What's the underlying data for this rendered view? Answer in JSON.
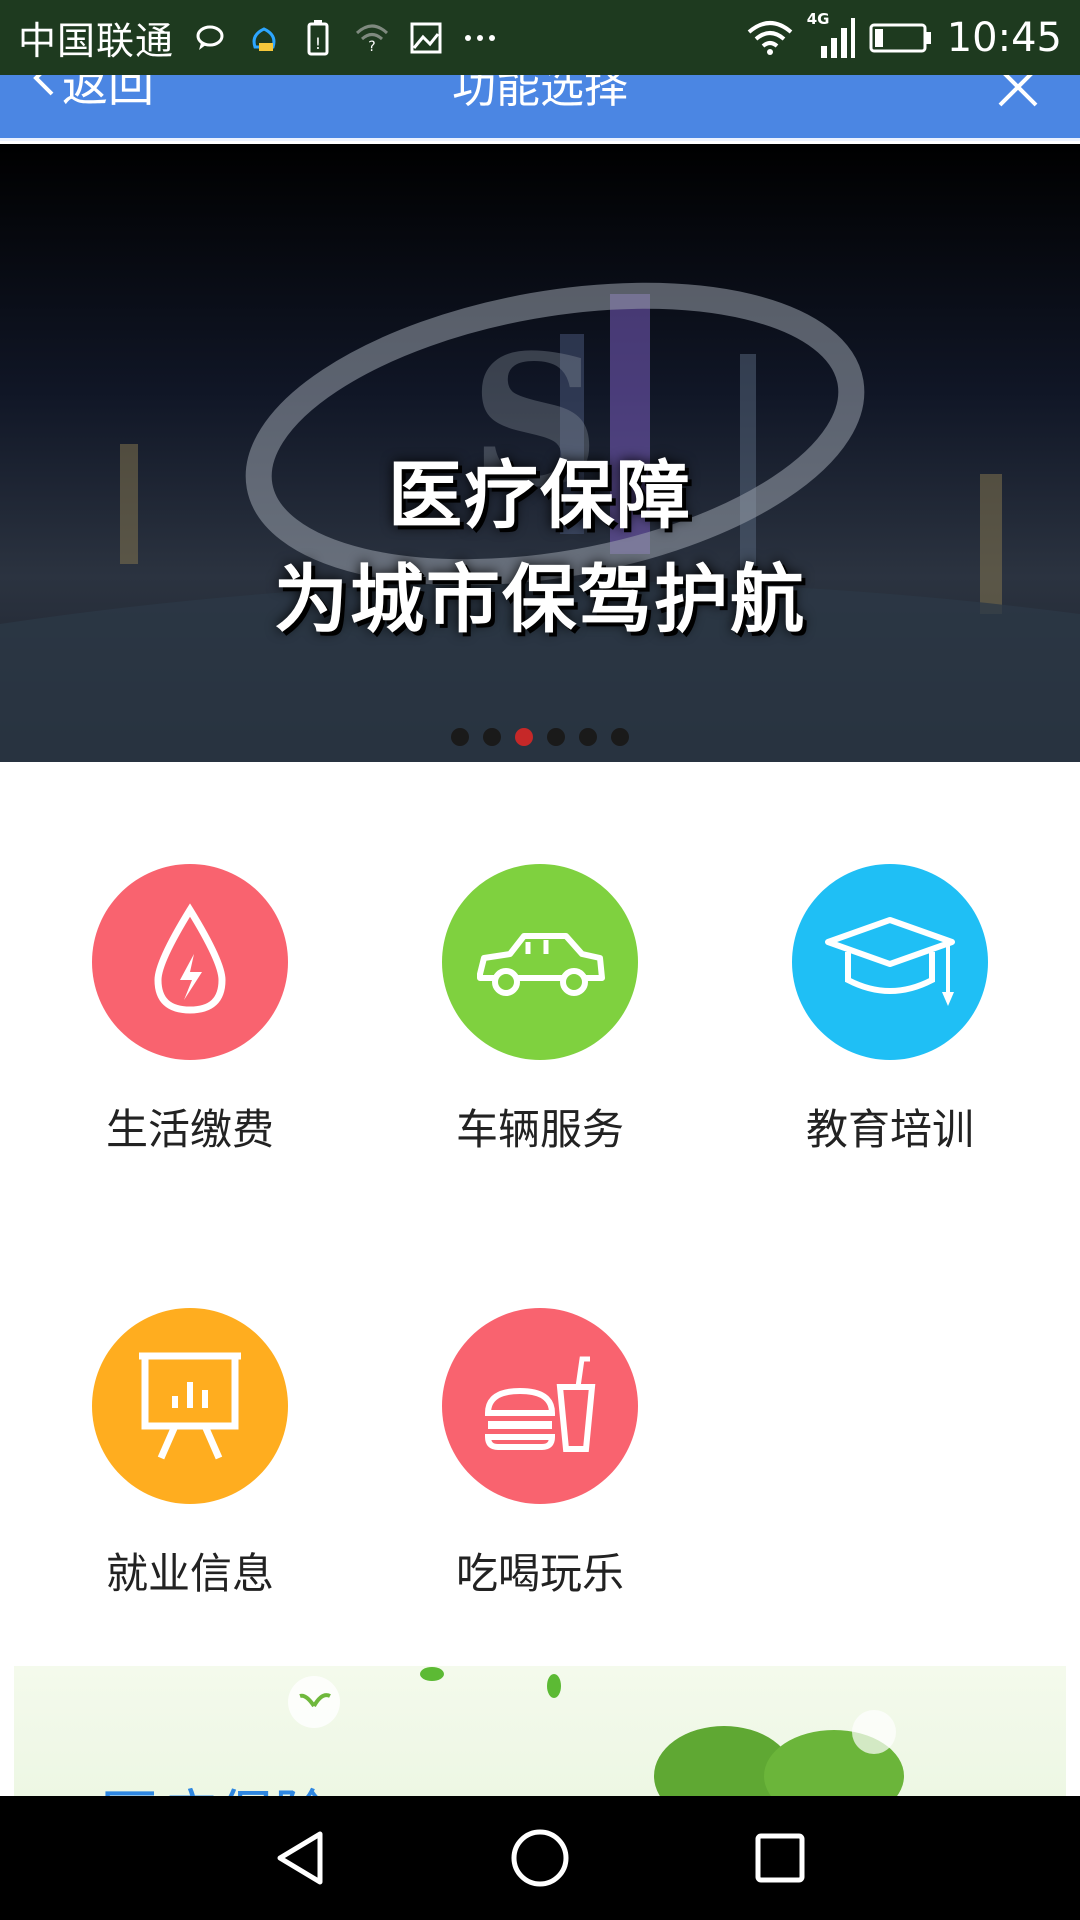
{
  "status_bar": {
    "carrier": "中国联通",
    "time": "10:45",
    "network": "4G",
    "icons": [
      "chat-icon",
      "cloud-icon",
      "battery-saver-icon",
      "wifi-question-icon",
      "image-icon",
      "more-icon",
      "wifi-icon",
      "signal-icon",
      "battery-icon"
    ]
  },
  "title_bar": {
    "back_label": "返回",
    "title": "功能选择",
    "bg_color": "#4b86e3"
  },
  "banner": {
    "line1": "医疗保障",
    "line2": "为城市保驾护航",
    "dot_count": 6,
    "active_dot": 2
  },
  "tiles": [
    {
      "label": "生活缴费",
      "icon": "water-drop-lightning-icon",
      "color": "#f9636f"
    },
    {
      "label": "车辆服务",
      "icon": "car-icon",
      "color": "#7fd13f"
    },
    {
      "label": "教育培训",
      "icon": "graduation-cap-icon",
      "color": "#1fbff5"
    },
    {
      "label": "就业信息",
      "icon": "presentation-board-icon",
      "color": "#ffad1f"
    },
    {
      "label": "吃喝玩乐",
      "icon": "burger-drink-icon",
      "color": "#f9636f"
    }
  ],
  "promo": {
    "title": "医疗保险"
  },
  "nav_bar": {
    "icons": [
      "back-triangle-icon",
      "home-circle-icon",
      "recents-square-icon"
    ]
  }
}
